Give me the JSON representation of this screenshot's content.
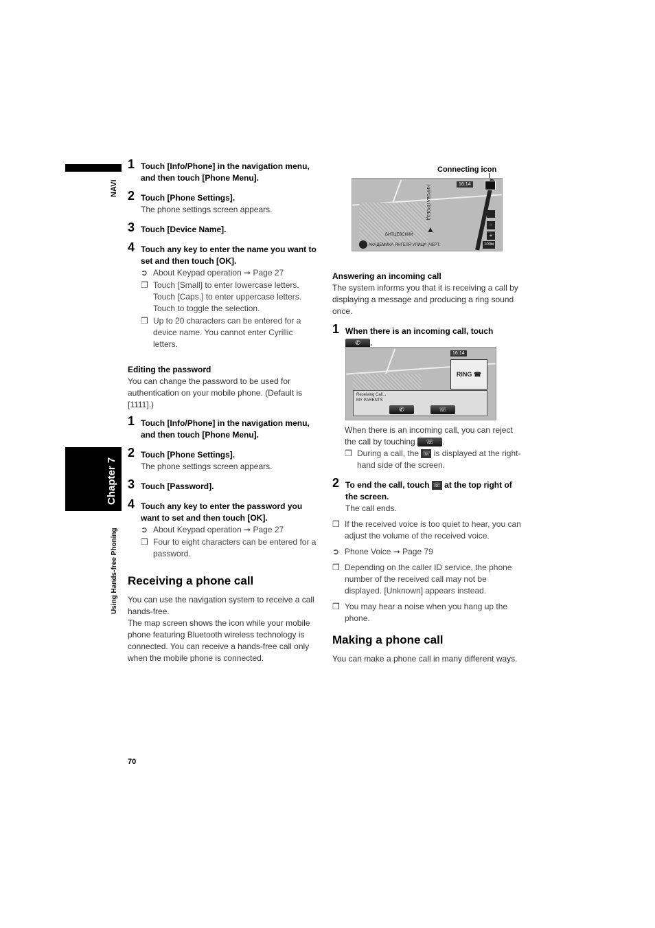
{
  "side": {
    "navi": "NAVI",
    "chapter": "Chapter 7",
    "section": "Using Hands-free Phoning"
  },
  "page_number": "70",
  "left": {
    "steps_a": [
      {
        "n": "1",
        "text": "Touch [Info/Phone] in the navigation menu, and then touch [Phone Menu]."
      },
      {
        "n": "2",
        "text": "Touch [Phone Settings].",
        "body": "The phone settings screen appears."
      },
      {
        "n": "3",
        "text": "Touch [Device Name]."
      },
      {
        "n": "4",
        "text": "Touch any key to enter the name you want to set and then touch [OK]."
      }
    ],
    "notes_a": [
      {
        "mark": "➲",
        "text": "About Keypad operation ➞ Page 27"
      },
      {
        "mark": "❒",
        "text": "Touch [Small] to enter lowercase letters. Touch [Caps.] to enter uppercase letters. Touch to toggle the selection."
      },
      {
        "mark": "❒",
        "text": "Up to 20 characters can be entered for a device name. You cannot enter Cyrillic letters."
      }
    ],
    "edit_heading": "Editing the password",
    "edit_body": "You can change the password to be used for authentication on your mobile phone. (Default is [1111].)",
    "steps_b": [
      {
        "n": "1",
        "text": "Touch [Info/Phone] in the navigation menu, and then touch [Phone Menu]."
      },
      {
        "n": "2",
        "text": "Touch [Phone Settings].",
        "body": "The phone settings screen appears."
      },
      {
        "n": "3",
        "text": "Touch [Password]."
      },
      {
        "n": "4",
        "text": "Touch any key to enter the password you want to set and then touch [OK]."
      }
    ],
    "notes_b": [
      {
        "mark": "➲",
        "text": "About Keypad operation ➞ Page 27"
      },
      {
        "mark": "❒",
        "text": "Four to eight characters can be entered for a password."
      }
    ],
    "receiving_title": "Receiving a phone call",
    "receiving_body1": "You can use the navigation system to receive a call hands-free.",
    "receiving_body2": "The map screen shows the icon while your mobile phone featuring Bluetooth wireless technology is connected. You can receive a hands-free call only when the mobile phone is connected."
  },
  "right": {
    "connecting_label": "Connecting icon",
    "map1": {
      "time": "16:14",
      "street": "АКАДЕМИКА ЯНГЕЛЯ УЛИЦА (ЧЕРТ.",
      "road": "КИРОВА ПРОЕЗД",
      "district": "БИТЦЕВСКИЙ",
      "scale": "100м"
    },
    "answer_heading": "Answering an incoming call",
    "answer_body": "The system informs you that it is receiving a call by displaying a message and producing a ring sound once.",
    "step1": {
      "n": "1",
      "text": "When there is an incoming call, touch"
    },
    "map2": {
      "time": "16:14",
      "status": "Receiving Call...",
      "caller": "MY PARENTS",
      "ring": "RING"
    },
    "reject_a": "When there is an incoming call, you can reject the call by touching",
    "during_a": "During a call, the",
    "during_b": "is displayed at the right-hand side of the screen.",
    "step2": {
      "n": "2",
      "text_a": "To end the call, touch",
      "text_b": "at the top right of the screen.",
      "body": "The call ends."
    },
    "notes": [
      {
        "mark": "❒",
        "text": "If the received voice is too quiet to hear, you can adjust the volume of the received voice."
      },
      {
        "mark": "➲",
        "text": "Phone Voice ➞ Page 79"
      },
      {
        "mark": "❒",
        "text": "Depending on the caller ID service, the phone number of the received call may not be displayed. [Unknown] appears instead."
      },
      {
        "mark": "❒",
        "text": "You may hear a noise when you hang up the phone."
      }
    ],
    "making_title": "Making a phone call",
    "making_body": "You can make a phone call in many different ways."
  }
}
